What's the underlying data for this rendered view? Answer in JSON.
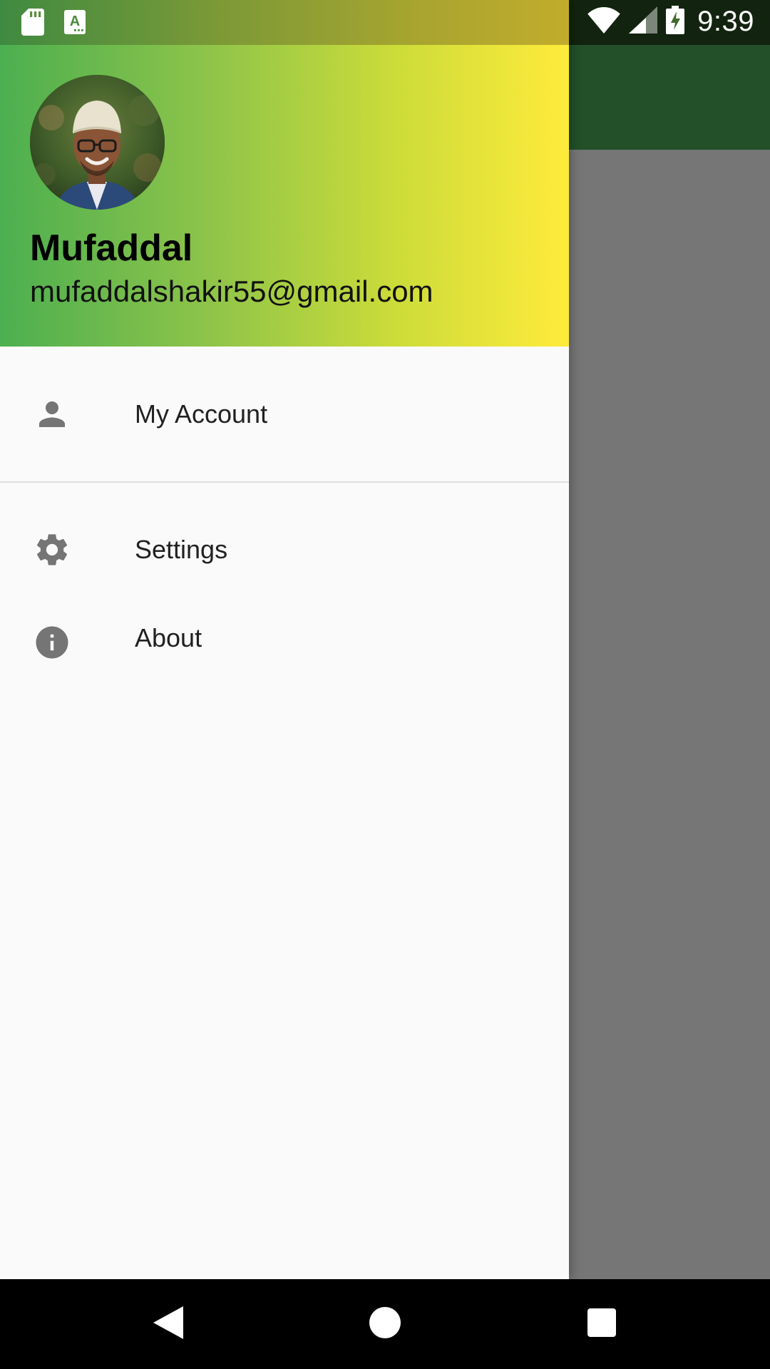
{
  "status_bar": {
    "time": "9:39",
    "icons": [
      "sd-card-icon",
      "text-recognition-icon",
      "wifi-icon",
      "signal-icon",
      "battery-charging-icon"
    ]
  },
  "drawer": {
    "header": {
      "name": "Mufaddal",
      "email": "mufaddalshakir55@gmail.com",
      "gradient": [
        "#4caf50",
        "#8bc34a",
        "#cddc39",
        "#ffeb3b"
      ]
    },
    "items": [
      {
        "label": "My Account",
        "icon": "person-icon"
      },
      {
        "label": "Settings",
        "icon": "gear-icon"
      },
      {
        "label": "About",
        "icon": "info-icon"
      }
    ]
  },
  "background_app": {
    "appbar_color": "#235028"
  },
  "nav_bar": {
    "buttons": [
      "back-icon",
      "home-icon",
      "recents-icon"
    ]
  }
}
